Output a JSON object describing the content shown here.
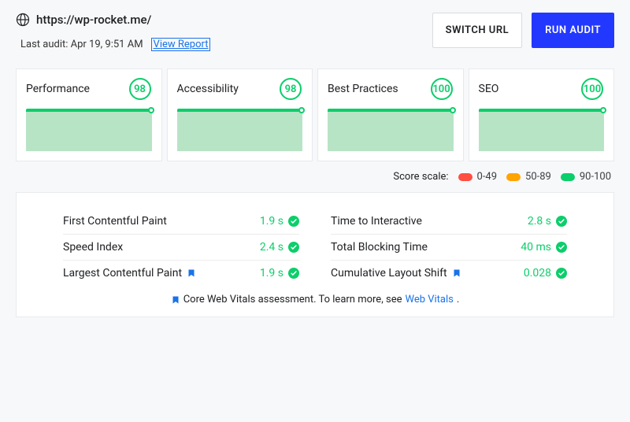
{
  "header": {
    "url": "https://wp-rocket.me/",
    "last_audit_label": "Last audit: Apr 19, 9:51 AM",
    "view_report_label": "View Report",
    "switch_url_label": "SWITCH URL",
    "run_audit_label": "RUN AUDIT"
  },
  "scores": [
    {
      "title": "Performance",
      "score": "98"
    },
    {
      "title": "Accessibility",
      "score": "98"
    },
    {
      "title": "Best Practices",
      "score": "100"
    },
    {
      "title": "SEO",
      "score": "100"
    }
  ],
  "scale": {
    "label": "Score scale:",
    "ranges": [
      {
        "range": "0-49",
        "color": "#ff4e42"
      },
      {
        "range": "50-89",
        "color": "#ffa400"
      },
      {
        "range": "90-100",
        "color": "#0cce6b"
      }
    ]
  },
  "metrics": {
    "left": [
      {
        "name": "First Contentful Paint",
        "value": "1.9 s",
        "cwv": false
      },
      {
        "name": "Speed Index",
        "value": "2.4 s",
        "cwv": false
      },
      {
        "name": "Largest Contentful Paint",
        "value": "1.9 s",
        "cwv": true
      }
    ],
    "right": [
      {
        "name": "Time to Interactive",
        "value": "2.8 s",
        "cwv": false
      },
      {
        "name": "Total Blocking Time",
        "value": "40 ms",
        "cwv": false
      },
      {
        "name": "Cumulative Layout Shift",
        "value": "0.028",
        "cwv": true
      }
    ]
  },
  "cwv_footer": {
    "text": "Core Web Vitals assessment. To learn more, see ",
    "link_label": "Web Vitals",
    "period": "."
  }
}
